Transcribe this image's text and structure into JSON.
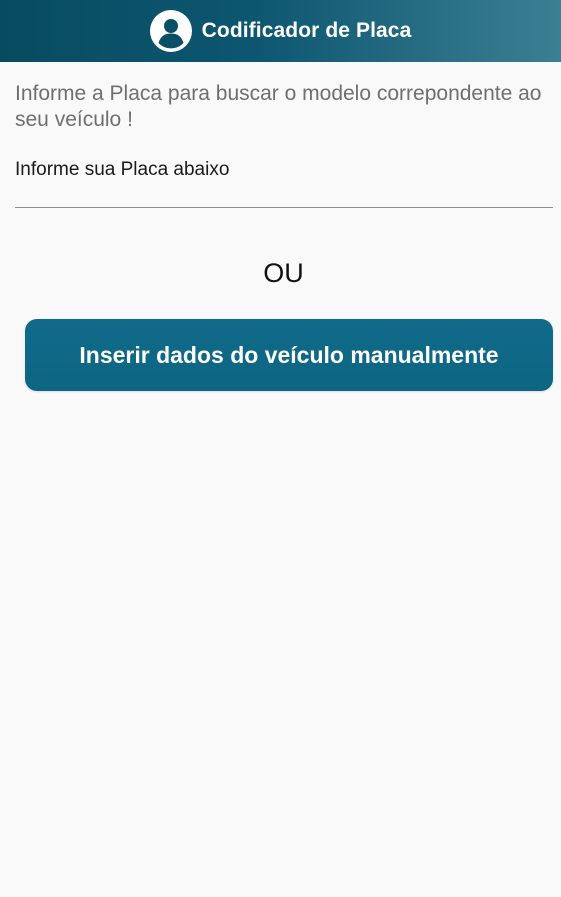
{
  "app_bar": {
    "title": "Codificador de Placa",
    "icon": "user-avatar-icon",
    "gradient_start": "#074b61",
    "gradient_end": "#3b7f93"
  },
  "main": {
    "intro_text": "Informe a Placa para buscar o modelo correpondente ao seu veículo !",
    "plate_field": {
      "placeholder": "Informe sua Placa abaixo",
      "value": ""
    },
    "separator_text": "OU",
    "manual_button": {
      "label": "Inserir dados do veículo manualmente",
      "color": "#0e6886"
    }
  }
}
